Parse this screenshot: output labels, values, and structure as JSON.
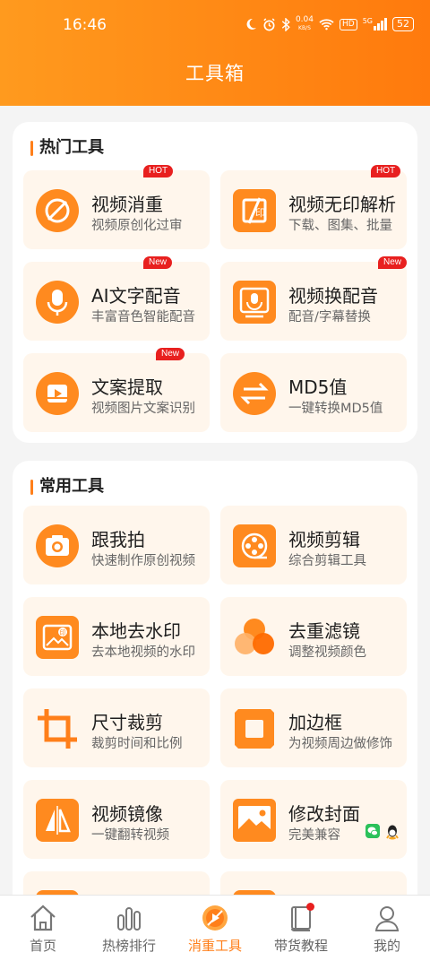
{
  "status_bar": {
    "time": "16:46",
    "net_speed_value": "0.04",
    "net_speed_unit": "KB/S",
    "hd_label": "HD",
    "signal_label": "5G",
    "battery": "52"
  },
  "header": {
    "title": "工具箱"
  },
  "colors": {
    "accent": "#ff7f1a",
    "badge": "#e8201f",
    "tile_bg": "#fff6ec"
  },
  "hot_section": {
    "title": "热门工具",
    "tools": [
      {
        "name": "视频消重",
        "desc": "视频原创化过审",
        "badge": "HOT",
        "icon": "no-copy-icon"
      },
      {
        "name": "视频无印解析",
        "desc": "下载、图集、批量",
        "badge": "HOT",
        "icon": "watermark-parse-icon"
      },
      {
        "name": "AI文字配音",
        "desc": "丰富音色智能配音",
        "badge": "New",
        "icon": "microphone-icon"
      },
      {
        "name": "视频换配音",
        "desc": "配音/字幕替换",
        "badge": "New",
        "icon": "dubbing-swap-icon"
      },
      {
        "name": "文案提取",
        "desc": "视频图片文案识别",
        "badge": "New",
        "icon": "text-extract-icon"
      },
      {
        "name": "MD5值",
        "desc": "一键转换MD5值",
        "badge": "",
        "icon": "swap-arrows-icon"
      }
    ]
  },
  "common_section": {
    "title": "常用工具",
    "tools": [
      {
        "name": "跟我拍",
        "desc": "快速制作原创视频",
        "icon": "camera-icon"
      },
      {
        "name": "视频剪辑",
        "desc": "综合剪辑工具",
        "icon": "film-reel-icon"
      },
      {
        "name": "本地去水印",
        "desc": "去本地视频的水印",
        "icon": "remove-watermark-icon"
      },
      {
        "name": "去重滤镜",
        "desc": "调整视频颜色",
        "icon": "color-filter-icon"
      },
      {
        "name": "尺寸裁剪",
        "desc": "裁剪时间和比例",
        "icon": "crop-icon"
      },
      {
        "name": "加边框",
        "desc": "为视频周边做修饰",
        "icon": "frame-border-icon"
      },
      {
        "name": "视频镜像",
        "desc": "一键翻转视频",
        "icon": "mirror-icon"
      },
      {
        "name": "修改封面",
        "desc": "完美兼容",
        "icon": "cover-image-icon"
      }
    ]
  },
  "tabbar": {
    "items": [
      {
        "label": "首页",
        "icon": "home-icon"
      },
      {
        "label": "热榜排行",
        "icon": "ranking-icon"
      },
      {
        "label": "消重工具",
        "icon": "dedup-tool-icon",
        "active": true
      },
      {
        "label": "带货教程",
        "icon": "book-icon"
      },
      {
        "label": "我的",
        "icon": "profile-icon"
      }
    ]
  }
}
